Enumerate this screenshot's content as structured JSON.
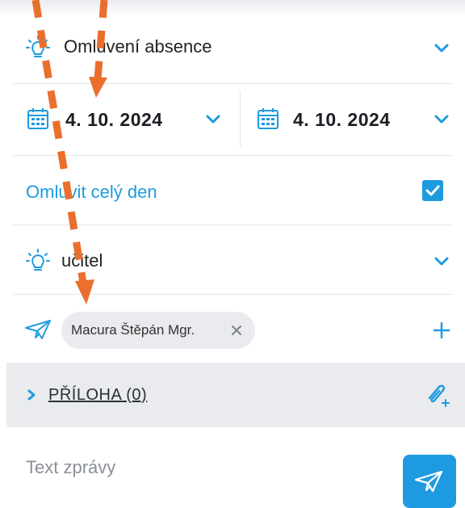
{
  "form": {
    "absence_type": "Omluvení absence",
    "date_from": "4. 10. 2024",
    "date_to": "4. 10. 2024",
    "full_day_label": "Omluvit celý den",
    "full_day_checked": true,
    "recipient_role": "učitel",
    "recipients": [
      {
        "name": "Macura Štěpán Mgr."
      }
    ],
    "attachment_label": "PŘÍLOHA (0)",
    "message_placeholder": "Text zprávy"
  },
  "colors": {
    "accent": "#1e9be0",
    "annotation_arrow": "#ea6f2d",
    "chip_bg": "#e9ebee"
  },
  "icons": {
    "absence_type": "lightbulb-icon",
    "date": "calendar-icon",
    "role": "lightbulb-icon",
    "recipient": "paper-plane-icon",
    "add": "plus-icon",
    "attach": "paperclip-plus-icon",
    "send": "paper-plane-icon"
  }
}
